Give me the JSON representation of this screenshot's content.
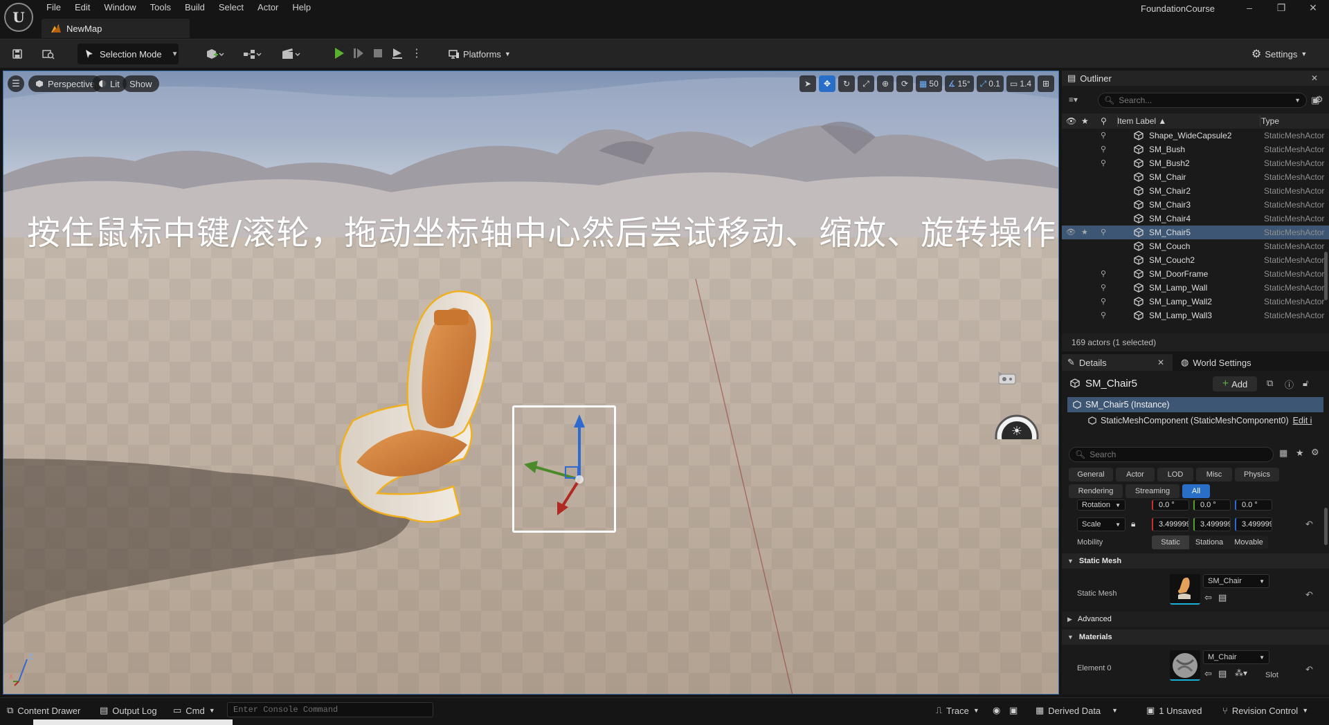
{
  "colors": {
    "accent": "#2a6fc7",
    "selection": "#3c5674",
    "panel": "#1a1a1a",
    "toolbar": "#242424"
  },
  "menubar": {
    "logo": "unreal-engine-logo",
    "items": [
      "File",
      "Edit",
      "Window",
      "Tools",
      "Build",
      "Select",
      "Actor",
      "Help"
    ],
    "project_name": "FoundationCourse",
    "window_controls": [
      "minimize-icon",
      "restore-icon",
      "close-icon"
    ]
  },
  "doc_tab": {
    "label": "NewMap",
    "icon": "map-icon"
  },
  "toolbar": {
    "save_icon": "save-icon",
    "browse_icon": "content-browse-icon",
    "selection_mode": "Selection Mode",
    "platforms": "Platforms",
    "settings": "Settings"
  },
  "viewport": {
    "menu_icon": "hamburger-icon",
    "perspective": "Perspective",
    "lit": "Lit",
    "show": "Show",
    "grid_snap": "50",
    "rotation_snap": "15°",
    "scale_snap": "0.1",
    "camera_speed": "1.4",
    "overlay_text": "按住鼠标中键/滚轮，拖动坐标轴中心然后尝试移动、缩放、旋转操作",
    "axis_labels": {
      "z": "Z",
      "x": "X"
    }
  },
  "outliner": {
    "title": "Outliner",
    "search_placeholder": "Search...",
    "columns": {
      "label": "Item Label ▲",
      "type": "Type"
    },
    "rows": [
      {
        "name": "Shape_WideCapsule2",
        "type": "StaticMeshActor",
        "pinned": true,
        "selected": false
      },
      {
        "name": "SM_Bush",
        "type": "StaticMeshActor",
        "pinned": true,
        "selected": false
      },
      {
        "name": "SM_Bush2",
        "type": "StaticMeshActor",
        "pinned": true,
        "selected": false
      },
      {
        "name": "SM_Chair",
        "type": "StaticMeshActor",
        "pinned": false,
        "selected": false
      },
      {
        "name": "SM_Chair2",
        "type": "StaticMeshActor",
        "pinned": false,
        "selected": false
      },
      {
        "name": "SM_Chair3",
        "type": "StaticMeshActor",
        "pinned": false,
        "selected": false
      },
      {
        "name": "SM_Chair4",
        "type": "StaticMeshActor",
        "pinned": false,
        "selected": false
      },
      {
        "name": "SM_Chair5",
        "type": "StaticMeshActor",
        "pinned": true,
        "selected": true
      },
      {
        "name": "SM_Couch",
        "type": "StaticMeshActor",
        "pinned": false,
        "selected": false
      },
      {
        "name": "SM_Couch2",
        "type": "StaticMeshActor",
        "pinned": false,
        "selected": false
      },
      {
        "name": "SM_DoorFrame",
        "type": "StaticMeshActor",
        "pinned": true,
        "selected": false
      },
      {
        "name": "SM_Lamp_Wall",
        "type": "StaticMeshActor",
        "pinned": true,
        "selected": false
      },
      {
        "name": "SM_Lamp_Wall2",
        "type": "StaticMeshActor",
        "pinned": true,
        "selected": false
      },
      {
        "name": "SM_Lamp_Wall3",
        "type": "StaticMeshActor",
        "pinned": true,
        "selected": false
      }
    ],
    "footer": "169 actors (1 selected)"
  },
  "details": {
    "tab_details": "Details",
    "tab_world": "World Settings",
    "actor_name": "SM_Chair5",
    "add_label": "Add",
    "instance": "SM_Chair5 (Instance)",
    "component": "StaticMeshComponent (StaticMeshComponent0)",
    "edit_link": "Edit i",
    "search_placeholder": "Search",
    "filters_row1": [
      "General",
      "Actor",
      "LOD",
      "Misc",
      "Physics"
    ],
    "filters_row2": [
      "Rendering",
      "Streaming",
      "All"
    ],
    "active_filter": "All",
    "rotation_label": "Rotation",
    "rotation_values": [
      "0.0 °",
      "0.0 °",
      "0.0 °"
    ],
    "scale_label": "Scale",
    "scale_values": [
      "3.499999",
      "3.499999",
      "3.499999"
    ],
    "mobility_label": "Mobility",
    "mobility_options": [
      "Static",
      "Stationa",
      "Movable"
    ],
    "mobility_selected": "Static",
    "section_static_mesh": "Static Mesh",
    "static_mesh_label": "Static Mesh",
    "static_mesh_value": "SM_Chair",
    "section_advanced": "Advanced",
    "section_materials": "Materials",
    "element0_label": "Element 0",
    "element0_value": "M_Chair",
    "slot_label": "Slot"
  },
  "statusbar": {
    "content_drawer": "Content Drawer",
    "output_log": "Output Log",
    "cmd": "Cmd",
    "console_placeholder": "Enter Console Command",
    "trace": "Trace",
    "derived_data": "Derived Data",
    "unsaved": "1 Unsaved",
    "revision_control": "Revision Control"
  }
}
